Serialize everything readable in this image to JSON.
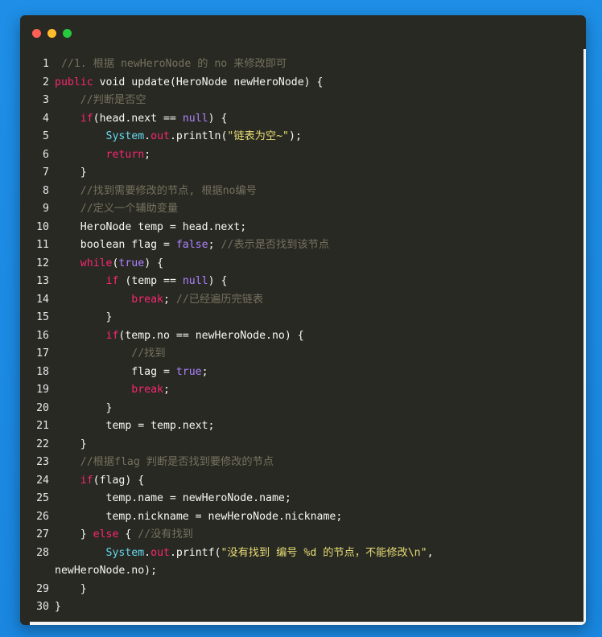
{
  "window": {
    "buttons": [
      "close",
      "minimize",
      "maximize"
    ]
  },
  "colors": {
    "background": "#1e88e5",
    "editor": "#282923",
    "keyword": "#f92672",
    "boolean": "#ae81ff",
    "string": "#e6db74",
    "comment": "#75715e",
    "builtin": "#66d9ef"
  },
  "code": {
    "lines": [
      {
        "no": "1",
        "tokens": [
          {
            "t": " //1. 根据 newHeroNode 的 no 来修改即可",
            "c": "cm"
          }
        ]
      },
      {
        "no": "2",
        "tokens": [
          {
            "t": "public",
            "c": "kw"
          },
          {
            "t": " void update(HeroNode newHeroNode) {",
            "c": "pl"
          }
        ]
      },
      {
        "no": "3",
        "tokens": [
          {
            "t": "    //判断是否空",
            "c": "cm"
          }
        ]
      },
      {
        "no": "4",
        "tokens": [
          {
            "t": "    ",
            "c": "pl"
          },
          {
            "t": "if",
            "c": "kw"
          },
          {
            "t": "(head.next == ",
            "c": "pl"
          },
          {
            "t": "null",
            "c": "bl"
          },
          {
            "t": ") {",
            "c": "pl"
          }
        ]
      },
      {
        "no": "5",
        "tokens": [
          {
            "t": "        ",
            "c": "pl"
          },
          {
            "t": "System",
            "c": "cy"
          },
          {
            "t": ".",
            "c": "pl"
          },
          {
            "t": "out",
            "c": "kw"
          },
          {
            "t": ".println(",
            "c": "pl"
          },
          {
            "t": "\"链表为空~\"",
            "c": "st"
          },
          {
            "t": ");",
            "c": "pl"
          }
        ]
      },
      {
        "no": "6",
        "tokens": [
          {
            "t": "        ",
            "c": "pl"
          },
          {
            "t": "return",
            "c": "kw"
          },
          {
            "t": ";",
            "c": "pl"
          }
        ]
      },
      {
        "no": "7",
        "tokens": [
          {
            "t": "    }",
            "c": "pl"
          }
        ]
      },
      {
        "no": "8",
        "tokens": [
          {
            "t": "    //找到需要修改的节点, 根据no编号",
            "c": "cm"
          }
        ]
      },
      {
        "no": "9",
        "tokens": [
          {
            "t": "    //定义一个辅助变量",
            "c": "cm"
          }
        ]
      },
      {
        "no": "10",
        "tokens": [
          {
            "t": "    HeroNode temp = head.next;",
            "c": "pl"
          }
        ]
      },
      {
        "no": "11",
        "tokens": [
          {
            "t": "    boolean flag = ",
            "c": "pl"
          },
          {
            "t": "false",
            "c": "bl"
          },
          {
            "t": "; ",
            "c": "pl"
          },
          {
            "t": "//表示是否找到该节点",
            "c": "cm"
          }
        ]
      },
      {
        "no": "12",
        "tokens": [
          {
            "t": "    ",
            "c": "pl"
          },
          {
            "t": "while",
            "c": "kw"
          },
          {
            "t": "(",
            "c": "pl"
          },
          {
            "t": "true",
            "c": "bl"
          },
          {
            "t": ") {",
            "c": "pl"
          }
        ]
      },
      {
        "no": "13",
        "tokens": [
          {
            "t": "        ",
            "c": "pl"
          },
          {
            "t": "if",
            "c": "kw"
          },
          {
            "t": " (temp == ",
            "c": "pl"
          },
          {
            "t": "null",
            "c": "bl"
          },
          {
            "t": ") {",
            "c": "pl"
          }
        ]
      },
      {
        "no": "14",
        "tokens": [
          {
            "t": "            ",
            "c": "pl"
          },
          {
            "t": "break",
            "c": "kw"
          },
          {
            "t": "; ",
            "c": "pl"
          },
          {
            "t": "//已经遍历完链表",
            "c": "cm"
          }
        ]
      },
      {
        "no": "15",
        "tokens": [
          {
            "t": "        }",
            "c": "pl"
          }
        ]
      },
      {
        "no": "16",
        "tokens": [
          {
            "t": "        ",
            "c": "pl"
          },
          {
            "t": "if",
            "c": "kw"
          },
          {
            "t": "(temp.no == newHeroNode.no) {",
            "c": "pl"
          }
        ]
      },
      {
        "no": "17",
        "tokens": [
          {
            "t": "            //找到",
            "c": "cm"
          }
        ]
      },
      {
        "no": "18",
        "tokens": [
          {
            "t": "            flag = ",
            "c": "pl"
          },
          {
            "t": "true",
            "c": "bl"
          },
          {
            "t": ";",
            "c": "pl"
          }
        ]
      },
      {
        "no": "19",
        "tokens": [
          {
            "t": "            ",
            "c": "pl"
          },
          {
            "t": "break",
            "c": "kw"
          },
          {
            "t": ";",
            "c": "pl"
          }
        ]
      },
      {
        "no": "20",
        "tokens": [
          {
            "t": "        }",
            "c": "pl"
          }
        ]
      },
      {
        "no": "21",
        "tokens": [
          {
            "t": "        temp = temp.next;",
            "c": "pl"
          }
        ]
      },
      {
        "no": "22",
        "tokens": [
          {
            "t": "    }",
            "c": "pl"
          }
        ]
      },
      {
        "no": "23",
        "tokens": [
          {
            "t": "    //根据flag 判断是否找到要修改的节点",
            "c": "cm"
          }
        ]
      },
      {
        "no": "24",
        "tokens": [
          {
            "t": "    ",
            "c": "pl"
          },
          {
            "t": "if",
            "c": "kw"
          },
          {
            "t": "(flag) {",
            "c": "pl"
          }
        ]
      },
      {
        "no": "25",
        "tokens": [
          {
            "t": "        temp.name = newHeroNode.name;",
            "c": "pl"
          }
        ]
      },
      {
        "no": "26",
        "tokens": [
          {
            "t": "        temp.nickname = newHeroNode.nickname;",
            "c": "pl"
          }
        ]
      },
      {
        "no": "27",
        "tokens": [
          {
            "t": "    } ",
            "c": "pl"
          },
          {
            "t": "else",
            "c": "kw"
          },
          {
            "t": " { ",
            "c": "pl"
          },
          {
            "t": "//没有找到",
            "c": "cm"
          }
        ]
      },
      {
        "no": "28",
        "tokens": [
          {
            "t": "        ",
            "c": "pl"
          },
          {
            "t": "System",
            "c": "cy"
          },
          {
            "t": ".",
            "c": "pl"
          },
          {
            "t": "out",
            "c": "kw"
          },
          {
            "t": ".printf(",
            "c": "pl"
          },
          {
            "t": "\"没有找到 编号 %d 的节点，不能修改\\n\"",
            "c": "st"
          },
          {
            "t": ",",
            "c": "pl"
          }
        ]
      },
      {
        "no": "",
        "tokens": [
          {
            "t": "newHeroNode.no);",
            "c": "pl"
          }
        ],
        "wrap": true
      },
      {
        "no": "29",
        "tokens": [
          {
            "t": "    }",
            "c": "pl"
          }
        ]
      },
      {
        "no": "30",
        "tokens": [
          {
            "t": "}",
            "c": "pl"
          }
        ]
      }
    ]
  }
}
